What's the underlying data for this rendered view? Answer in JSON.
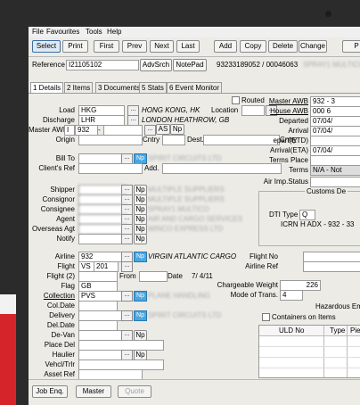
{
  "menu": [
    "File",
    "Favourites",
    "Tools",
    "Help"
  ],
  "toolbar": {
    "select": "Select",
    "print": "Print",
    "first": "First",
    "prev": "Prev",
    "next": "Next",
    "last": "Last",
    "add": "Add",
    "copy": "Copy",
    "delete": "Delete",
    "change": "Change",
    "p": "P"
  },
  "reference": {
    "label": "Reference",
    "value": "I21105102",
    "advsrch": "AdvSrch",
    "notepad": "NotePad",
    "number": "93233189052 / 00046063",
    "blurred": "SPRAY1 MULTICO"
  },
  "tabs": [
    "1 Details",
    "2 Items",
    "3 Documents",
    "5 Stats",
    "6 Event Monitor"
  ],
  "routed": "Routed",
  "left": {
    "load": {
      "label": "Load",
      "code": "HKG",
      "place": "HONG KONG, HK"
    },
    "discharge": {
      "label": "Discharge",
      "code": "LHR",
      "place": "LONDON HEATHROW, GB"
    },
    "master_awb": {
      "label": "Master AWB",
      "v1": "I",
      "v2": "932",
      "v3": "-",
      "as": "AS",
      "np": "Np"
    },
    "origin": {
      "label": "Origin",
      "cntry": "Cntry",
      "dest": "Dest.",
      "cntry2": "Cntry"
    },
    "location": "Location",
    "bill_to": "Bill To",
    "clients_ref": "Client's Ref",
    "add": "Add.",
    "shipper": "Shipper",
    "consignor": "Consignor",
    "consignee": "Consignee",
    "agent": "Agent",
    "overseas_agt": "Overseas Agt",
    "notify": "Notify",
    "shipper_name": "MULTIPLE SUPPLIERS",
    "consignor_name": "MULTIPLE SUPPLIERS",
    "consignee_name": "SPRAY1 MULTICO",
    "agent_name": "AIR AND CARGO SERVICES",
    "overseas_name": "WINCO EXPRESS LTD",
    "billto_name": "SPIRIT CIRCUITS LTD",
    "airline": {
      "label": "Airline",
      "value": "932",
      "name": "VIRGIN ATLANTIC CARGO"
    },
    "flight": {
      "label": "Flight",
      "carrier": "VS",
      "num": "201"
    },
    "flight2": {
      "label": "Flight (2)",
      "from": "From",
      "date": "Date",
      "date_val": "7/ 4/11"
    },
    "flag": {
      "label": "Flag",
      "value": "GB"
    },
    "collection": {
      "label": "Collection",
      "value": "PVS",
      "name": "PLANE HANDLING"
    },
    "col_date": "Col.Date",
    "delivery": "Delivery",
    "delivery_name": "SPIRIT CIRCUITS LTD",
    "del_date": "Del.Date",
    "de_van": "De-Van",
    "place_del": "Place Del",
    "haulier": "Haulier",
    "vehcl": "Vehcl/Trlr",
    "asset_ref": "Asset Ref"
  },
  "right": {
    "master_awb": {
      "label": "Master AWB",
      "value": "932 - 3"
    },
    "house_awb": {
      "label": "House AWB",
      "value": "000 6"
    },
    "departed": {
      "label": "Departed",
      "value": "07/04/"
    },
    "arrival": {
      "label": "Arrival",
      "value": "07/04/"
    },
    "depart_etd": "epart(ETD)",
    "arrival_eta": {
      "label": "Arrival(ETA)",
      "value": "07/04/"
    },
    "terms_place": "Terms Place",
    "terms": {
      "label": "Terms",
      "value": "N/A - Not"
    },
    "air_imp_status": "Air Imp.Status",
    "customs": "Customs De",
    "dti_type": {
      "label": "DTI Type",
      "value": "Q"
    },
    "icrn": {
      "label": "ICRN",
      "value": "H ADX - 932 - 33"
    },
    "flight_no": "Flight No",
    "airline_ref": "Airline Ref",
    "chargeable_weight": {
      "label": "Chargeable Weight",
      "value": "226"
    },
    "mode_of_trans": {
      "label": "Mode of Trans.",
      "value": "4"
    },
    "hazardous": "Hazardous Em",
    "containers": "Containers on Items",
    "uld_headers": [
      "ULD No",
      "Type",
      "Pie"
    ]
  },
  "bottom": {
    "job_enq": "Job Enq.",
    "master": "Master",
    "quote": "Quote"
  }
}
